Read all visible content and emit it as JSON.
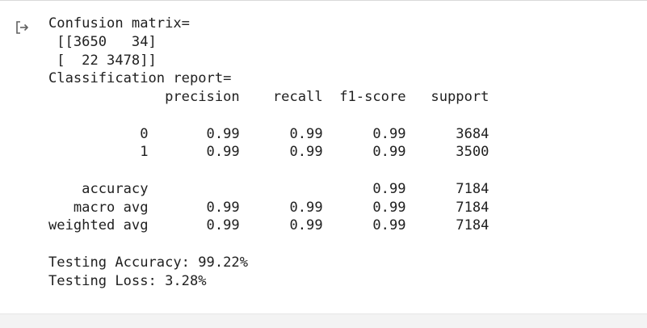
{
  "output": {
    "icon": "output-arrow-icon",
    "lines": [
      "Confusion matrix=",
      " [[3650   34]",
      " [  22 3478]]",
      "Classification report=",
      "              precision    recall  f1-score   support",
      "",
      "           0       0.99      0.99      0.99      3684",
      "           1       0.99      0.99      0.99      3500",
      "",
      "    accuracy                           0.99      7184",
      "   macro avg       0.99      0.99      0.99      7184",
      "weighted avg       0.99      0.99      0.99      7184",
      "",
      "Testing Accuracy: 99.22%",
      "Testing Loss: 3.28%"
    ]
  },
  "colors": {
    "text": "#212121",
    "icon": "#616161",
    "next_cell_bg": "#f3f3f3"
  }
}
